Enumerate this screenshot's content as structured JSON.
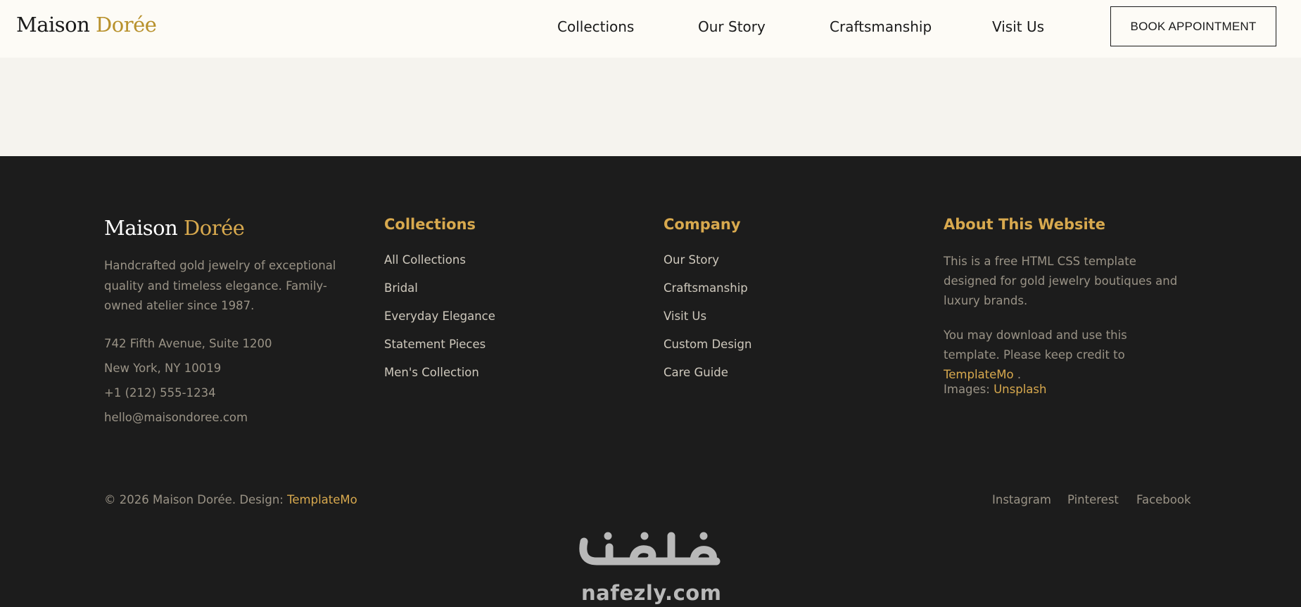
{
  "header": {
    "logo": {
      "main": "Maison",
      "accent": "Dorée"
    },
    "nav": [
      "Collections",
      "Our Story",
      "Craftsmanship",
      "Visit Us"
    ],
    "cta_label": "BOOK APPOINTMENT"
  },
  "footer": {
    "brand": {
      "logo": {
        "main": "Maison",
        "accent": "Dorée"
      },
      "description": "Handcrafted gold jewelry of exceptional quality and timeless elegance. Family-owned atelier since 1987.",
      "address_line1": "742 Fifth Avenue, Suite 1200",
      "address_line2": "New York, NY 10019",
      "phone": "+1 (212) 555-1234",
      "email": "hello@maisondoree.com"
    },
    "collections": {
      "title": "Collections",
      "links": [
        "All Collections",
        "Bridal",
        "Everyday Elegance",
        "Statement Pieces",
        "Men's Collection"
      ]
    },
    "company": {
      "title": "Company",
      "links": [
        "Our Story",
        "Craftsmanship",
        "Visit Us",
        "Custom Design",
        "Care Guide"
      ]
    },
    "about": {
      "title": "About This Website",
      "p1": "This is a free HTML CSS template designed for gold jewelry boutiques and luxury brands.",
      "p2_text": "You may download and use this template. Please keep credit to",
      "p2_link": "TemplateMo",
      "p2_end": ".",
      "p3_text": "Images:",
      "p3_link": "Unsplash"
    },
    "bottom": {
      "copyright_text": "© 2026 Maison Dorée. Design:",
      "copyright_link": "TemplateMo",
      "social": [
        "Instagram",
        "Pinterest",
        "Facebook"
      ]
    }
  },
  "watermark": {
    "latin": "nafezly.com"
  },
  "colors": {
    "header_bg": "#fdfbf6",
    "hero_bg": "#f5f3ee",
    "footer_bg": "#1c1c1c",
    "gold": "#d8a94e",
    "logo_gold": "#b8912c",
    "muted_text": "#9a9386",
    "link_text": "#cfc9bd",
    "watermark": "#b9b9b9"
  }
}
